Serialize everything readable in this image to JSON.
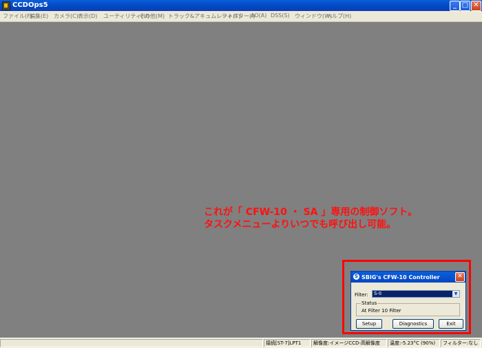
{
  "window": {
    "title": "CCDOps5",
    "minimize": "_",
    "maximize": "□",
    "close": "✕"
  },
  "menu": [
    "ファイル(F)",
    "編集(E)",
    "カメラ(C)",
    "表示(D)",
    "ユーティリティ(U)",
    "その他(M)",
    "トラック&アキュムレート(T)",
    "フィルター(I)",
    "AO(A)",
    "DSS(S)",
    "ウィンドウ(W)",
    "ヘルプ(H)"
  ],
  "annotation": {
    "line1": "これが「 CFW-10 ・ SA 」専用の制御ソフト。",
    "line2": "タスクメニューよりいつでも呼び出し可能。"
  },
  "dialog": {
    "title": "SBIG's CFW-10 Controller",
    "filter_label": "Filter:",
    "filter_value": "S-II",
    "status_legend": "Status",
    "status_text": "At Filter 10 Filter",
    "setup": "Setup",
    "diagnostics": "Diagnostics",
    "exit": "Exit"
  },
  "statusbar": {
    "connection": "接続[ST-7]LPT1",
    "resolution": "解像度:イメージCCD-高解像度",
    "temperature": "温度:-5.23°C (90%)",
    "filter": "フィルター:なし"
  },
  "colors": {
    "titlebar": "#0346c4",
    "workspace": "#808080",
    "annotation": "#ff1010",
    "highlight": "#ff0000"
  }
}
